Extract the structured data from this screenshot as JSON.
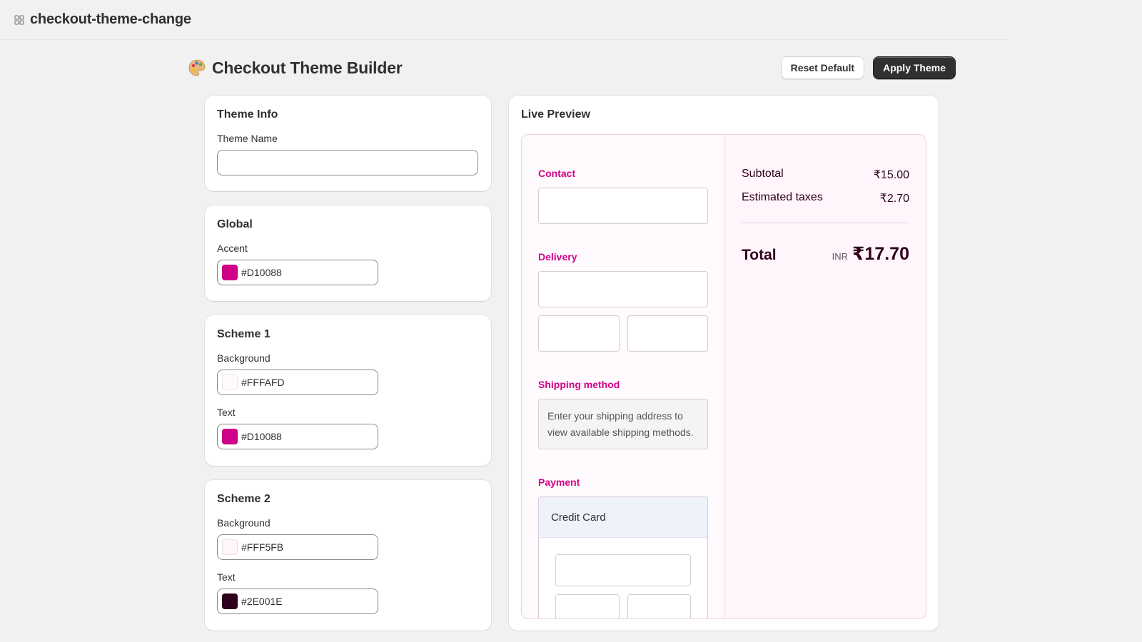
{
  "app": {
    "title": "checkout-theme-change"
  },
  "header": {
    "title": "Checkout Theme Builder",
    "reset_label": "Reset Default",
    "apply_label": "Apply Theme"
  },
  "theme_info": {
    "title": "Theme Info",
    "name_label": "Theme Name",
    "name_value": ""
  },
  "global": {
    "title": "Global",
    "accent_label": "Accent",
    "accent_value": "#D10088"
  },
  "scheme1": {
    "title": "Scheme 1",
    "background_label": "Background",
    "background_value": "#FFFAFD",
    "text_label": "Text",
    "text_value": "#D10088"
  },
  "scheme2": {
    "title": "Scheme 2",
    "background_label": "Background",
    "background_value": "#FFF5FB",
    "text_label": "Text",
    "text_value": "#2E001E"
  },
  "preview": {
    "title": "Live Preview",
    "contact_label": "Contact",
    "delivery_label": "Delivery",
    "shipping_label": "Shipping method",
    "shipping_message": "Enter your shipping address to view available shipping methods.",
    "payment_label": "Payment",
    "payment_method": "Credit Card",
    "summary": {
      "subtotal_label": "Subtotal",
      "subtotal_value": "₹15.00",
      "taxes_label": "Estimated taxes",
      "taxes_value": "₹2.70",
      "total_label": "Total",
      "currency": "INR",
      "total_value": "₹17.70"
    }
  },
  "colors": {
    "accent": "#D10088",
    "scheme1_bg": "#FFFAFD",
    "scheme2_bg": "#FFF5FB",
    "scheme2_text": "#2E001E",
    "primary_button": "#303030"
  },
  "icons": {
    "app": "grid-app-icon",
    "title": "palette-emoji-icon"
  }
}
